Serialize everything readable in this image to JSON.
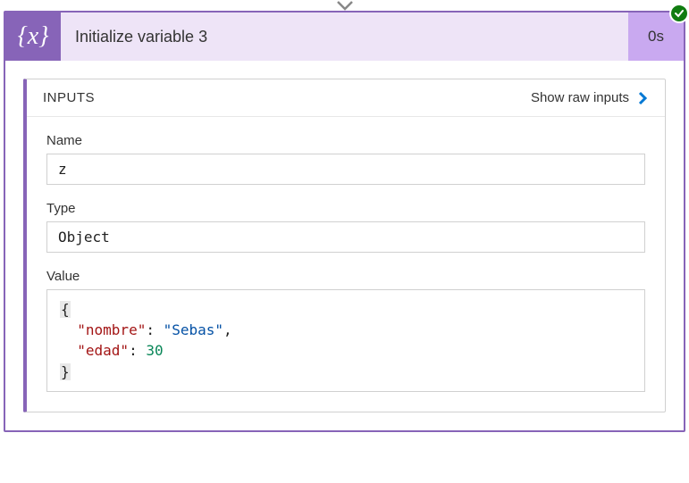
{
  "header": {
    "title": "Initialize variable 3",
    "duration": "0s",
    "icon_label": "{𝑥}"
  },
  "inputs": {
    "section_label": "INPUTS",
    "show_raw_label": "Show raw inputs",
    "fields": {
      "name": {
        "label": "Name",
        "value": "z"
      },
      "type": {
        "label": "Type",
        "value": "Object"
      },
      "value": {
        "label": "Value",
        "json": {
          "nombre": "Sebas",
          "edad": 30
        }
      }
    }
  }
}
